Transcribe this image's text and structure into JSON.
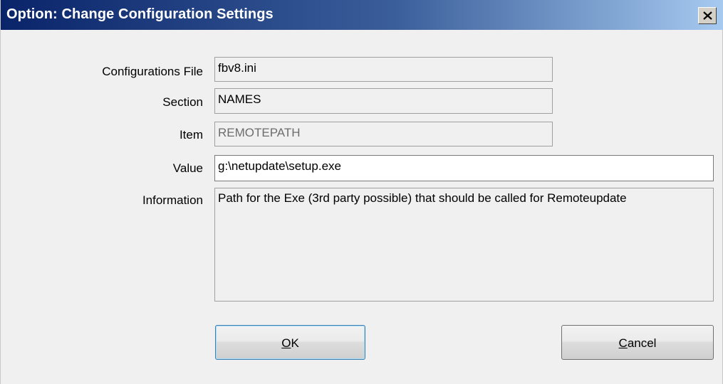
{
  "window": {
    "title": "Option: Change Configuration Settings",
    "title_colors": {
      "start": "#0a246a",
      "end": "#a6caf0"
    },
    "close_icon": "close-icon"
  },
  "form": {
    "config_file": {
      "label": "Configurations File",
      "value": "fbv8.ini"
    },
    "section": {
      "label": "Section",
      "value": "NAMES"
    },
    "item": {
      "label": "Item",
      "value": "REMOTEPATH"
    },
    "value": {
      "label": "Value",
      "value": "g:\\netupdate\\setup.exe"
    },
    "information": {
      "label": "Information",
      "value": "Path for the Exe (3rd party possible) that should be called for Remoteupdate"
    }
  },
  "buttons": {
    "ok": {
      "accel": "O",
      "rest": "K"
    },
    "cancel": {
      "accel": "C",
      "rest": "ancel"
    }
  }
}
